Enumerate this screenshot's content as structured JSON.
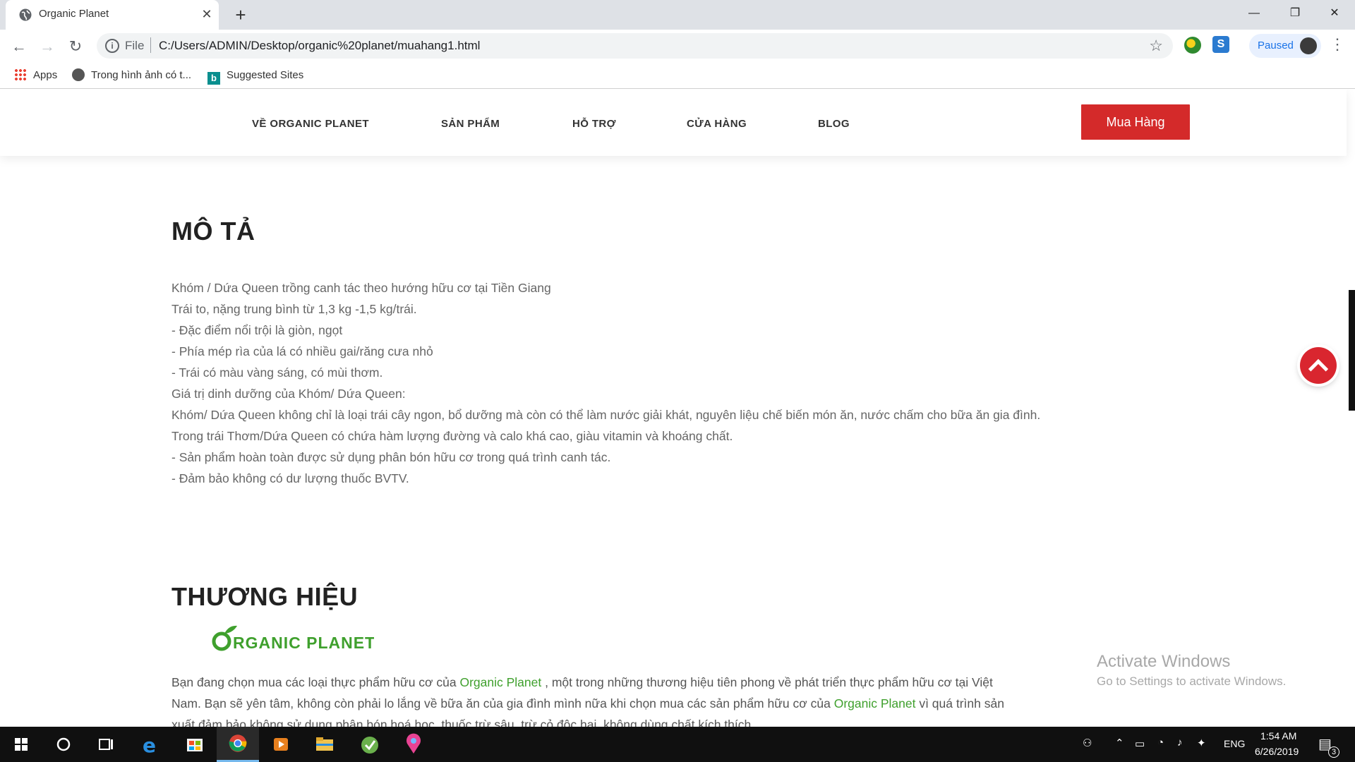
{
  "browser": {
    "tab_title": "Organic Planet",
    "new_tab_symbol": "+",
    "window_controls": {
      "minimize": "—",
      "restore": "❐",
      "close": "✕"
    },
    "address": {
      "scheme_label": "File",
      "url": "C:/Users/ADMIN/Desktop/organic%20planet/muahang1.html"
    },
    "profile_status": "Paused",
    "bookmarks": [
      {
        "label": "Apps",
        "icon": "apps-grid-icon"
      },
      {
        "label": "Trong hình ảnh có t...",
        "icon": "globe-icon"
      },
      {
        "label": "Suggested Sites",
        "icon": "bing-icon"
      }
    ]
  },
  "site": {
    "menu": [
      "VỀ ORGANIC PLANET",
      "SẢN PHẨM",
      "HỖ TRỢ",
      "CỬA HÀNG",
      "BLOG"
    ],
    "buy_button": "Mua Hàng"
  },
  "description": {
    "heading": "MÔ TẢ",
    "lines": [
      "Khóm / Dứa Queen trồng canh tác theo hướng hữu cơ tại Tiền Giang",
      "Trái to, nặng trung bình từ 1,3 kg -1,5 kg/trái.",
      "- Đặc điểm nổi trội là giòn, ngọt",
      "- Phía mép rìa của lá có nhiều gai/răng cưa nhỏ",
      "- Trái có màu vàng sáng, có mùi thơm.",
      "Giá trị dinh dưỡng của Khóm/ Dứa Queen:",
      "Khóm/ Dứa Queen không chỉ là loại trái cây ngon, bổ dưỡng mà còn có thể làm nước giải khát, nguyên liệu chế biến món ăn, nước chấm cho bữa ăn gia đình.",
      "Trong trái Thơm/Dứa Queen có chứa hàm lượng đường và calo khá cao, giàu vitamin và khoáng chất.",
      "- Sản phẩm hoàn toàn được sử dụng phân bón hữu cơ trong quá trình canh tác.",
      "- Đảm bảo không có dư lượng thuốc BVTV."
    ]
  },
  "brand": {
    "heading": "THƯƠNG HIỆU",
    "logo_text": "ORGANIC PLANET",
    "text_before": "Bạn đang chọn mua các loại thực phẩm hữu cơ của ",
    "link1": "Organic Planet",
    "text_middle": " , một trong những thương hiệu tiên phong về phát triển thực phẩm hữu cơ tại Việt Nam. Bạn sẽ yên tâm, không còn phải lo lắng về bữa ăn của gia đình mình nữa khi chọn mua các sản phẩm hữu cơ của ",
    "link2": "Organic Planet",
    "text_after": " vì quá trình sản xuất đảm bảo không sử dụng phân bón hoá học, thuốc trừ sâu, trừ cỏ độc hại, không dùng chất kích thích"
  },
  "watermark": {
    "title": "Activate Windows",
    "subtitle": "Go to Settings to activate Windows."
  },
  "taskbar": {
    "language": "ENG",
    "time": "1:54 AM",
    "date": "6/26/2019",
    "notification_count": "3"
  },
  "colors": {
    "accent_red": "#d42a2a",
    "brand_green": "#3fa02d"
  }
}
